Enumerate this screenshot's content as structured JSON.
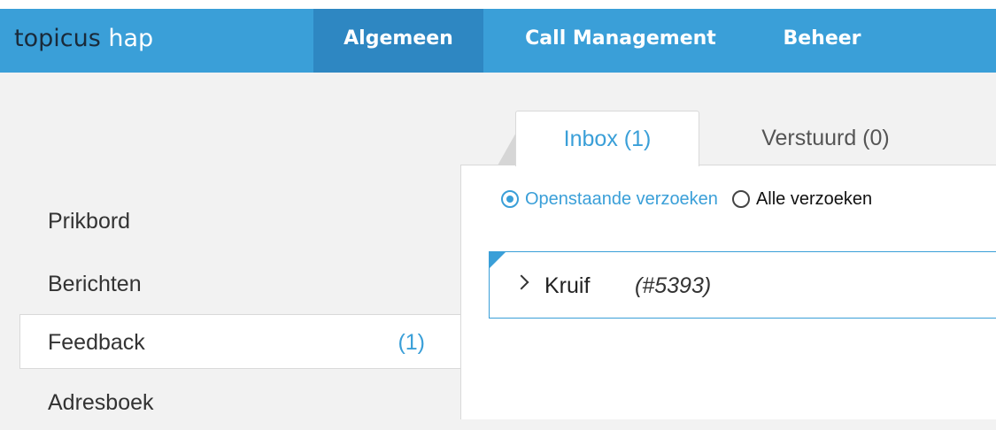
{
  "header": {
    "logo_part1": "topicus",
    "logo_part2": " hap",
    "nav": {
      "algemeen": "Algemeen",
      "call_management": "Call Management",
      "beheer": "Beheer"
    },
    "colors": {
      "bar": "#3a9fd8",
      "active": "#2e87c2"
    }
  },
  "sidebar": {
    "items": [
      {
        "label": "Prikbord"
      },
      {
        "label": "Berichten"
      },
      {
        "label": "Feedback",
        "count": "(1)",
        "active": true
      },
      {
        "label": "Adresboek"
      }
    ]
  },
  "tabs": {
    "inbox": "Inbox (1)",
    "verstuurd": "Verstuurd (0)"
  },
  "filters": {
    "open": "Openstaande verzoeken",
    "all": "Alle verzoeken",
    "selected": "open"
  },
  "requests": [
    {
      "name": "Kruif",
      "id": "(#5393)"
    }
  ],
  "icons": {
    "expand": "chevron-right-icon",
    "radio_checked": "radio-checked-icon",
    "radio_unchecked": "radio-unchecked-icon"
  }
}
